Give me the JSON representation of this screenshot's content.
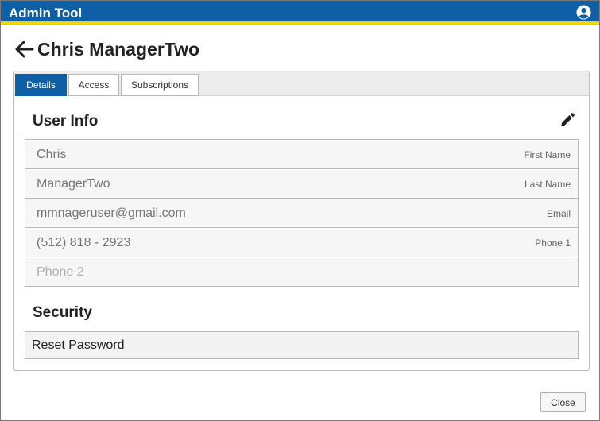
{
  "app": {
    "title": "Admin Tool"
  },
  "header": {
    "user_name": "Chris ManagerTwo"
  },
  "tabs": [
    {
      "label": "Details",
      "active": true
    },
    {
      "label": "Access",
      "active": false
    },
    {
      "label": "Subscriptions",
      "active": false
    }
  ],
  "user_info": {
    "title": "User Info",
    "fields": [
      {
        "value": "Chris",
        "label": "First Name"
      },
      {
        "value": "ManagerTwo",
        "label": "Last Name"
      },
      {
        "value": "mmnageruser@gmail.com",
        "label": "Email"
      },
      {
        "value": "(512) 818 - 2923",
        "label": "Phone 1"
      },
      {
        "placeholder": "Phone 2",
        "label": ""
      }
    ]
  },
  "security": {
    "title": "Security",
    "reset_label": "Reset Password"
  },
  "footer": {
    "close_label": "Close"
  },
  "colors": {
    "brand": "#0e5fa6",
    "accent": "#f3d400"
  },
  "icons": {
    "user": "user-circle-icon",
    "back": "arrow-left-icon",
    "edit": "pencil-icon"
  }
}
